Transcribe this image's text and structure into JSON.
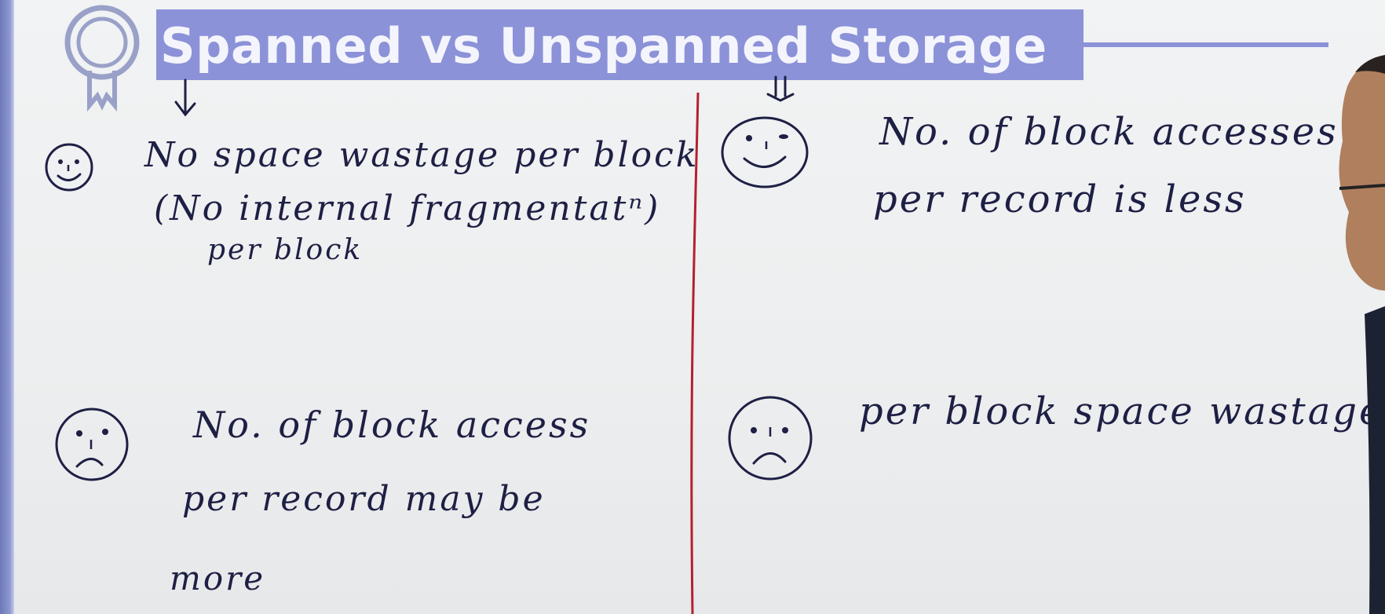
{
  "title": "Spanned vs Unspanned Storage",
  "colors": {
    "title_band": "#8c92d8",
    "ink": "#1e1f44",
    "divider": "#b4202e",
    "board": "#eef0f1"
  },
  "icons": {
    "badge": "award-ribbon-icon",
    "left_pointer": "down-arrow-icon",
    "right_pointer": "double-down-arrow-icon",
    "happy": "smiley-face-icon",
    "sad": "frowning-face-icon"
  },
  "left": {
    "advantage": {
      "line1": "No space wastage per block",
      "line2": "(No internal fragmentatⁿ)",
      "line3": "per block"
    },
    "disadvantage": {
      "line1": "No. of block access",
      "line2": "per record may be",
      "line3": "more"
    }
  },
  "right": {
    "advantage": {
      "line1": "No. of block accesses",
      "line2": "per record is less"
    },
    "disadvantage": {
      "line1": "per block space wastage"
    }
  }
}
